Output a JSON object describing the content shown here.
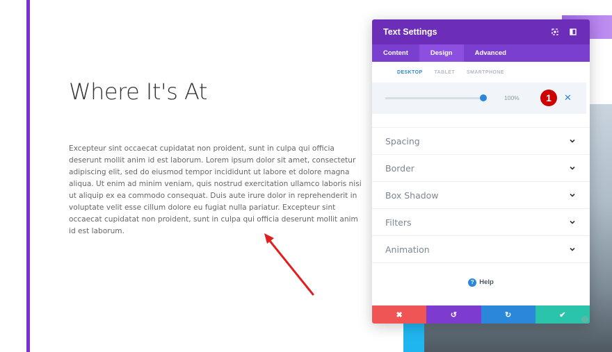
{
  "page": {
    "heading": "Where It's At",
    "body": "Excepteur sint occaecat cupidatat non proident, sunt in culpa qui officia deserunt mollit anim id est laborum. Lorem ipsum dolor sit amet, consectetur adipiscing elit, sed do eiusmod tempor incididunt ut labore et dolore magna aliqua. Ut enim ad minim veniam, quis nostrud exercitation ullamco laboris nisi ut aliquip ex ea commodo consequat. Duis aute irure dolor in reprehenderit in voluptate velit esse cillum dolore eu fugiat nulla pariatur. Excepteur sint occaecat cupidatat non proident, sunt in culpa qui officia deserunt mollit anim id est laborum."
  },
  "panel": {
    "title": "Text Settings",
    "tabs": [
      {
        "label": "Content"
      },
      {
        "label": "Design"
      },
      {
        "label": "Advanced"
      }
    ],
    "active_tab": "Design",
    "devices": [
      {
        "label": "DESKTOP"
      },
      {
        "label": "TABLET"
      },
      {
        "label": "SMARTPHONE"
      }
    ],
    "active_device": "DESKTOP",
    "slider": {
      "value_text": "100%",
      "fraction": 1.0
    },
    "badge": "1",
    "reset_glyph": "✕",
    "sections": [
      {
        "label": "Spacing"
      },
      {
        "label": "Border"
      },
      {
        "label": "Box Shadow"
      },
      {
        "label": "Filters"
      },
      {
        "label": "Animation"
      }
    ],
    "help": {
      "label": "Help",
      "icon_glyph": "?"
    },
    "actions": {
      "cancel_glyph": "✖",
      "undo_glyph": "↺",
      "redo_glyph": "↻",
      "save_glyph": "✔"
    }
  },
  "colors": {
    "accent_purple": "#6c2eb9",
    "accent_blue": "#2b87da",
    "cancel_red": "#ef5555",
    "save_green": "#29c4a9",
    "annotation_red": "#e02020"
  }
}
